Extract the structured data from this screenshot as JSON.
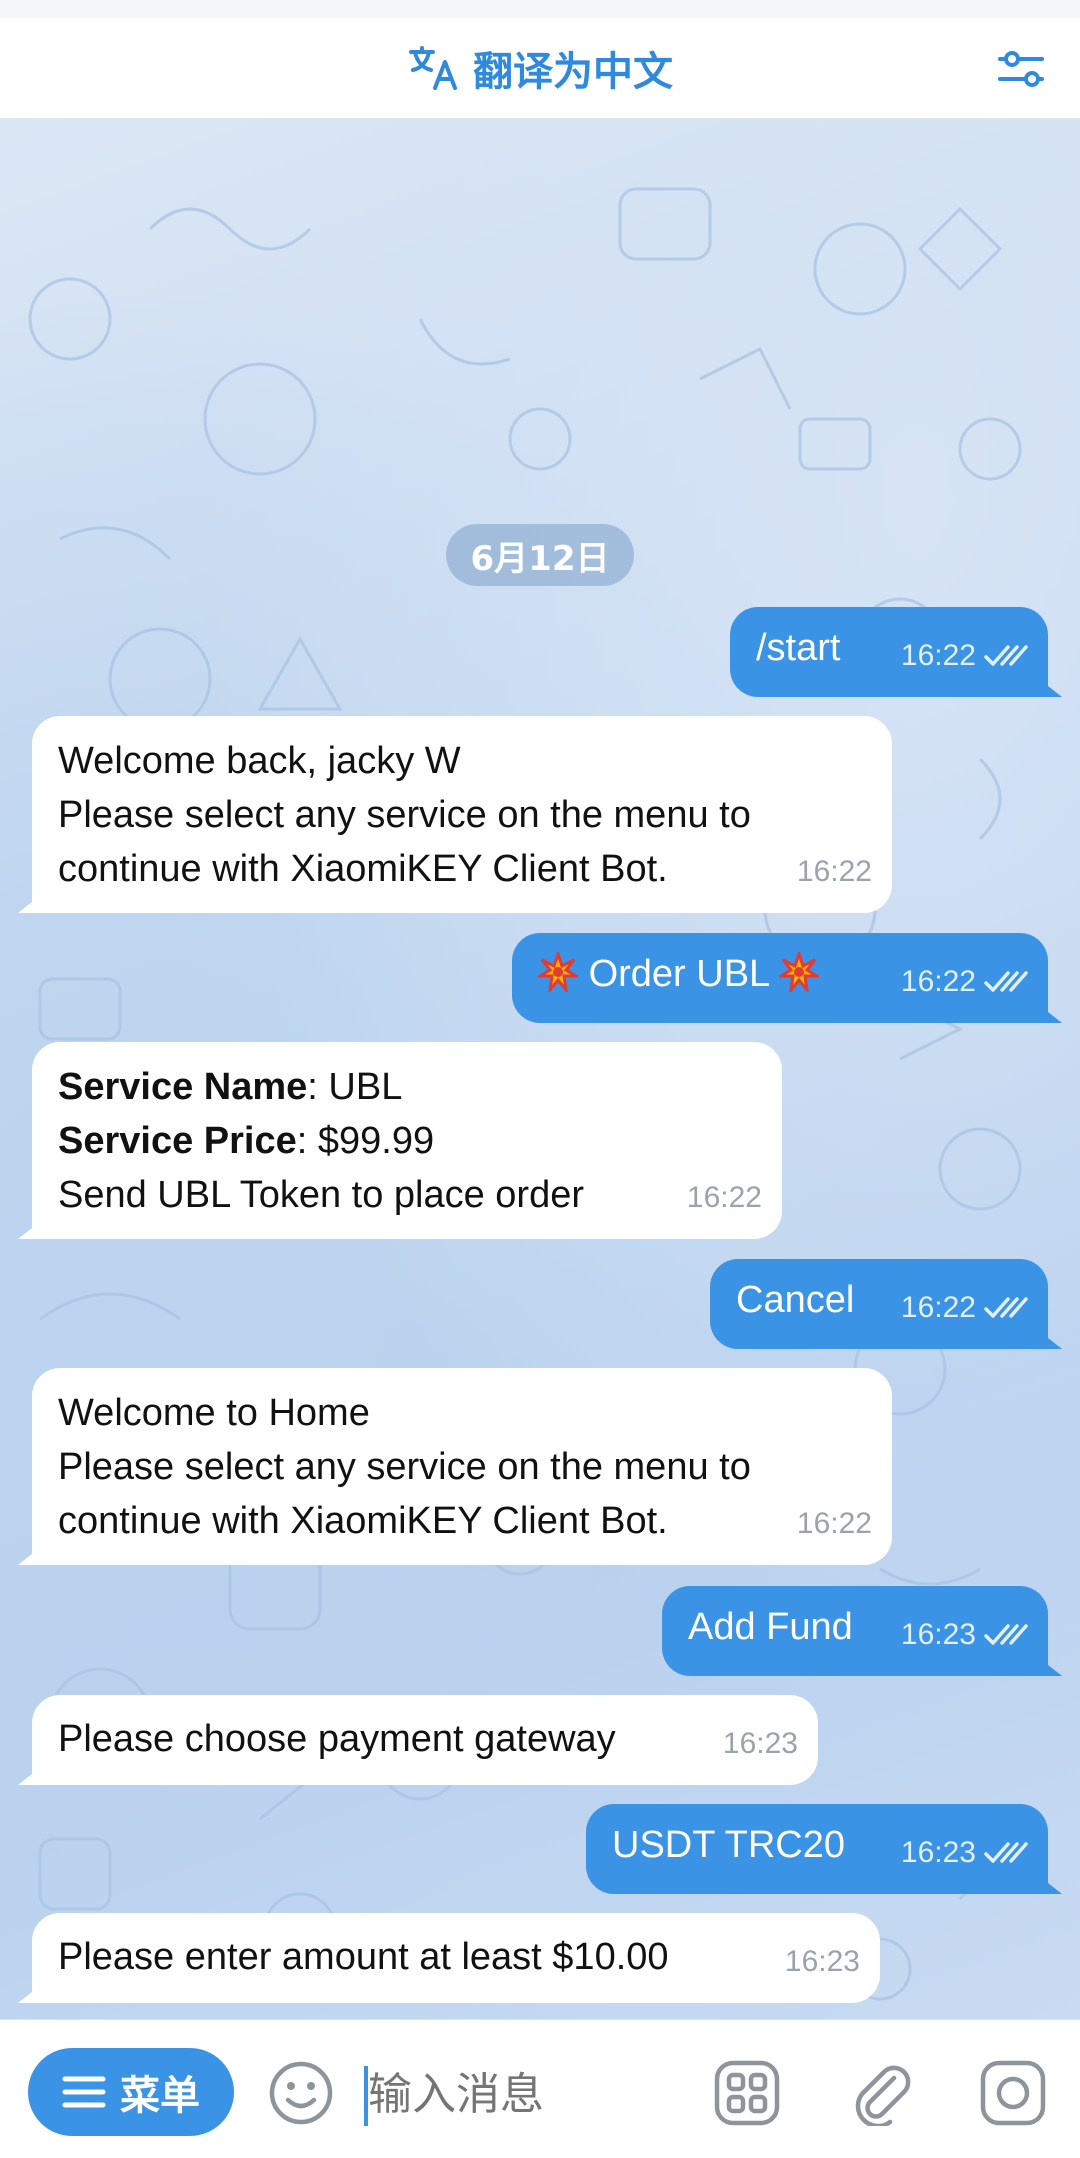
{
  "header": {
    "translate_label": "翻译为中文",
    "icons": {
      "translate": "translate-icon",
      "filter": "filter-sliders-icon"
    }
  },
  "date_separator": "6月12日",
  "messages": [
    {
      "dir": "out",
      "lines": [
        "/start"
      ],
      "time": "16:22",
      "status": "read"
    },
    {
      "dir": "in",
      "lines": [
        "Welcome back, jacky W",
        "Please select any service on the menu to",
        "continue with XiaomiKEY Client Bot."
      ],
      "time": "16:22"
    },
    {
      "dir": "out",
      "text": "Order UBL",
      "emoji": "collision",
      "time": "16:22",
      "status": "read"
    },
    {
      "dir": "in",
      "rich": [
        {
          "label": "Service  Name",
          "value": ": UBL"
        },
        {
          "label": "Service Price",
          "value": ": $99.99"
        }
      ],
      "lines": [
        "Send UBL Token to place order"
      ],
      "time": "16:22"
    },
    {
      "dir": "out",
      "lines": [
        "Cancel"
      ],
      "time": "16:22",
      "status": "read"
    },
    {
      "dir": "in",
      "lines": [
        "Welcome to Home",
        "Please select any service on the menu to",
        "continue with XiaomiKEY Client Bot."
      ],
      "time": "16:22"
    },
    {
      "dir": "out",
      "lines": [
        "Add Fund"
      ],
      "time": "16:23",
      "status": "read"
    },
    {
      "dir": "in",
      "lines": [
        "Please choose payment gateway"
      ],
      "time": "16:23"
    },
    {
      "dir": "out",
      "lines": [
        "USDT TRC20"
      ],
      "time": "16:23",
      "status": "read"
    },
    {
      "dir": "in",
      "lines": [
        "Please enter amount at least $10.00"
      ],
      "time": "16:23"
    }
  ],
  "input_bar": {
    "menu_label": "菜单",
    "placeholder": "输入消息",
    "icons": [
      "emoji-icon",
      "bot-commands-icon",
      "attach-icon",
      "camera-icon"
    ]
  },
  "colors": {
    "accent": "#3a93e4",
    "outgoing_bubble": "#3a93e4",
    "incoming_bubble": "#ffffff"
  }
}
